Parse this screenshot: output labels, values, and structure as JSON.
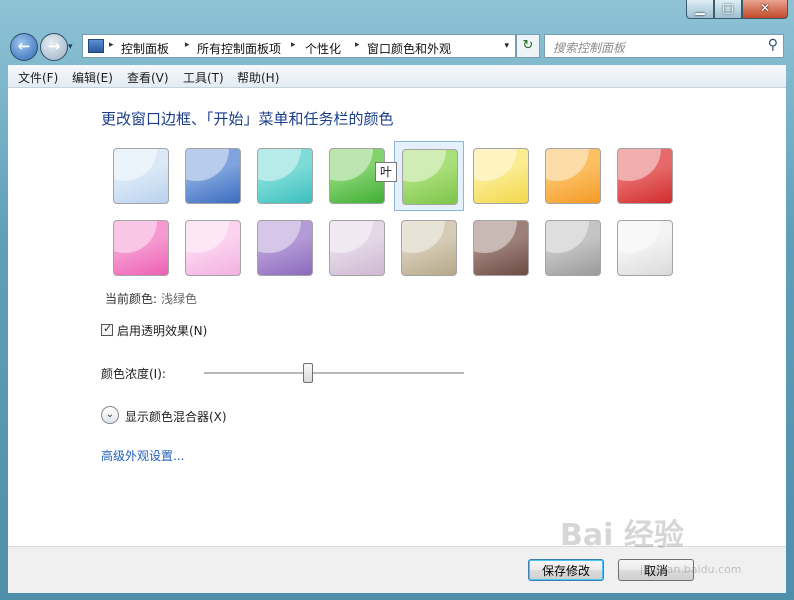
{
  "window": {
    "controls": {
      "minimize": "▁",
      "maximize": "□",
      "close": "✕"
    }
  },
  "nav": {
    "back_icon": "←",
    "forward_icon": "→",
    "breadcrumbs": [
      "控制面板",
      "所有控制面板项",
      "个性化",
      "窗口颜色和外观"
    ],
    "separator": "▸",
    "dropdown": "▾",
    "refresh_icon": "↻",
    "search_placeholder": "搜索控制面板",
    "search_icon": "⚲"
  },
  "menu": [
    "文件(F)",
    "编辑(E)",
    "查看(V)",
    "工具(T)",
    "帮助(H)"
  ],
  "content": {
    "heading": "更改窗口边框、「开始」菜单和任务栏的颜色",
    "tooltip": "叶",
    "swatches": [
      {
        "id": "sky",
        "color": "#dbe9f7",
        "dark": "#b9d2ee"
      },
      {
        "id": "twilight",
        "color": "#7fa3dc",
        "dark": "#3b6cc0"
      },
      {
        "id": "sea",
        "color": "#7ddbd8",
        "dark": "#3cc0bd"
      },
      {
        "id": "leaf",
        "color": "#83d26e",
        "dark": "#3fae34"
      },
      {
        "id": "lime",
        "color": "#a9de78",
        "dark": "#7cc54a"
      },
      {
        "id": "sun",
        "color": "#fbec90",
        "dark": "#f2d84a"
      },
      {
        "id": "pumpkin",
        "color": "#fbbf62",
        "dark": "#f59a25"
      },
      {
        "id": "ruby",
        "color": "#e76a6a",
        "dark": "#d12c2c"
      },
      {
        "id": "fuchsia",
        "color": "#f59ad0",
        "dark": "#ee5fb4"
      },
      {
        "id": "blush",
        "color": "#fbd3ef",
        "dark": "#f3b0e2"
      },
      {
        "id": "violet",
        "color": "#b49ad6",
        "dark": "#8a69bd"
      },
      {
        "id": "lavender",
        "color": "#e4d8e6",
        "dark": "#cdb8d2"
      },
      {
        "id": "taupe",
        "color": "#d6ccb6",
        "dark": "#b5a78a"
      },
      {
        "id": "chocolate",
        "color": "#9d8079",
        "dark": "#6b4b44"
      },
      {
        "id": "slate",
        "color": "#c4c4c4",
        "dark": "#9a9a9a"
      },
      {
        "id": "frost",
        "color": "#f3f3f3",
        "dark": "#dadada"
      }
    ],
    "selected_index": 4,
    "current_label": "当前颜色:",
    "current_value": "浅绿色",
    "transparency_label": "启用透明效果(N)",
    "transparency_checked": true,
    "checkmark": "✓",
    "intensity_label": "颜色浓度(I):",
    "intensity_value": 0.4,
    "mixer_icon": "⌄",
    "mixer_label": "显示颜色混合器(X)",
    "advanced_link": "高级外观设置..."
  },
  "footer": {
    "save": "保存修改",
    "cancel": "取消"
  },
  "watermark": {
    "main": "Bai 经验",
    "sub": "jingyan.baidu.com"
  }
}
